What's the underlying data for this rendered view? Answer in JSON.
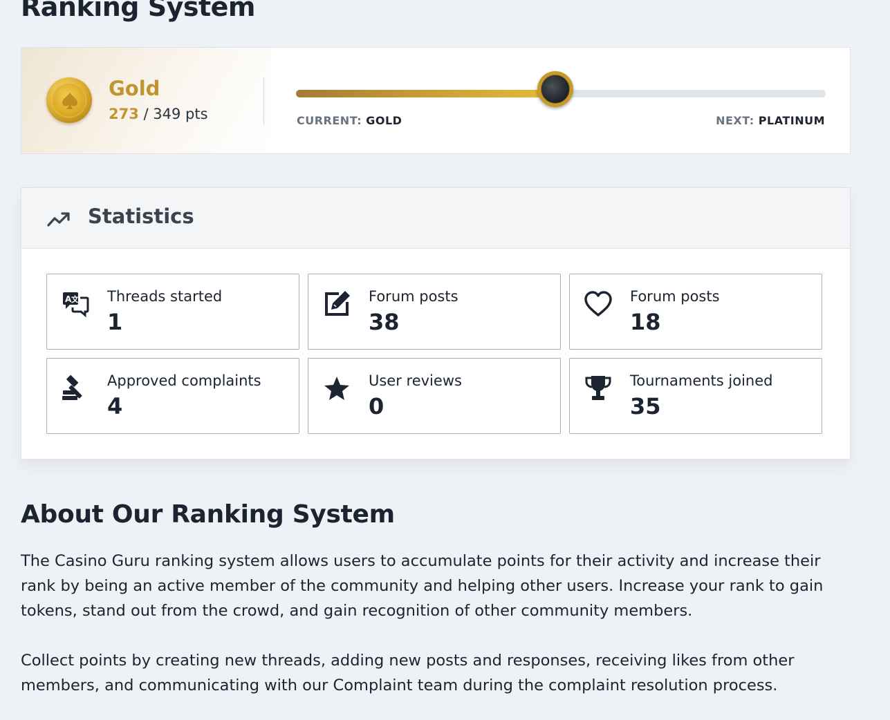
{
  "page": {
    "title": "Ranking System"
  },
  "rank": {
    "name": "Gold",
    "points_current": "273",
    "points_separator": " / ",
    "points_total": "349 pts",
    "progress_fraction": 0.49,
    "current_key": "CURRENT: ",
    "current_value": "GOLD",
    "next_key": "NEXT: ",
    "next_value": "PLATINUM",
    "medal_icon": "spade-medal-icon",
    "colors": {
      "gold": "#c09531",
      "track": "#e1e5ea"
    }
  },
  "statistics": {
    "title": "Statistics",
    "icon": "trending-up-icon",
    "items": [
      {
        "icon": "translate-chat-icon",
        "label": "Threads started",
        "value": "1"
      },
      {
        "icon": "edit-icon",
        "label": "Forum posts",
        "value": "38"
      },
      {
        "icon": "heart-icon",
        "label": "Forum posts",
        "value": "18"
      },
      {
        "icon": "gavel-icon",
        "label": "Approved complaints",
        "value": "4"
      },
      {
        "icon": "star-icon",
        "label": "User reviews",
        "value": "0"
      },
      {
        "icon": "trophy-icon",
        "label": "Tournaments joined",
        "value": "35"
      }
    ]
  },
  "about": {
    "title": "About Our Ranking System",
    "paragraph1": "The Casino Guru ranking system allows users to accumulate points for their activity and increase their rank by being an active member of the community and helping other users. Increase your rank to gain tokens, stand out from the crowd, and gain recognition of other community members.",
    "paragraph2": "Collect points by creating new threads, adding new posts and responses, receiving likes from other members, and communicating with our Complaint team during the complaint resolution process."
  }
}
